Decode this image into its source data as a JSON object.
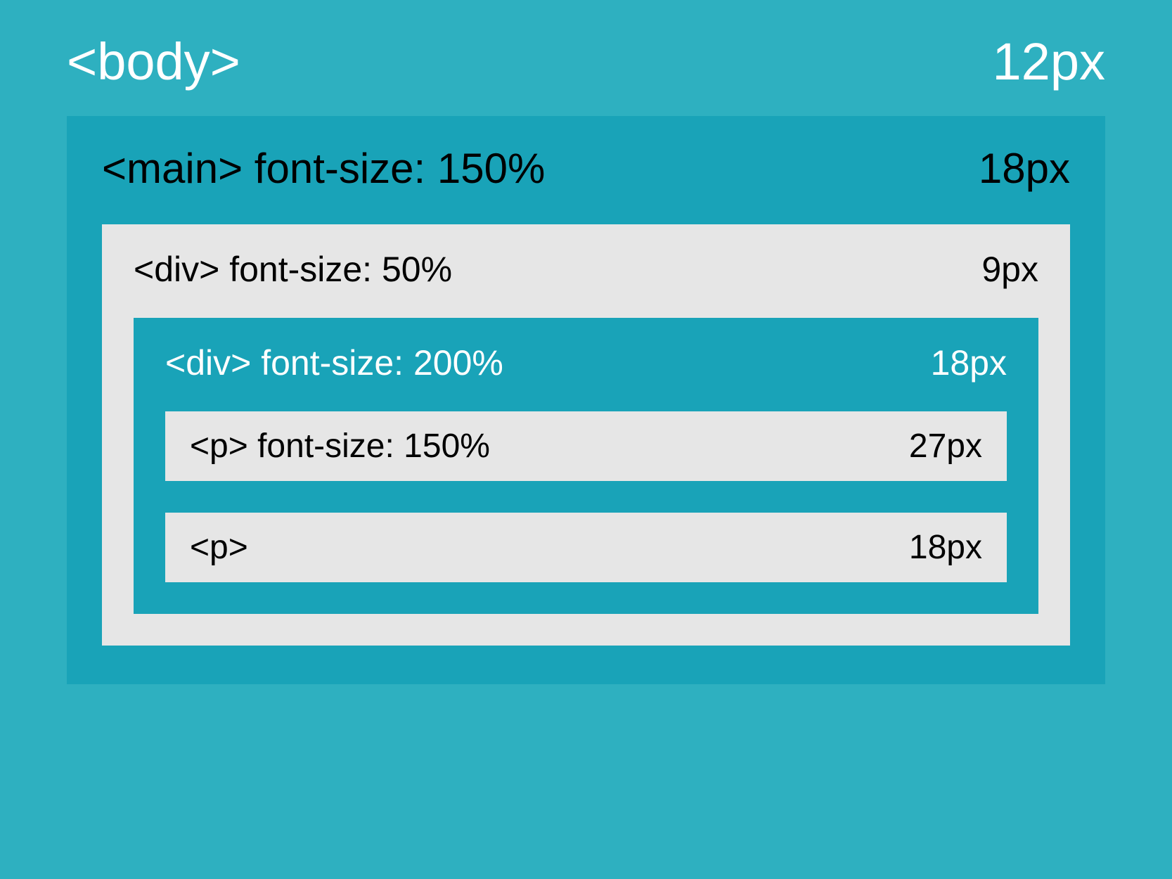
{
  "body": {
    "label": "<body>",
    "size": "12px"
  },
  "main": {
    "label": "<main> font-size: 150%",
    "size": "18px"
  },
  "div_outer": {
    "label": "<div> font-size: 50%",
    "size": "9px"
  },
  "div_inner": {
    "label": "<div> font-size: 200%",
    "size": "18px"
  },
  "p1": {
    "label": "<p> font-size: 150%",
    "size": "27px"
  },
  "p2": {
    "label": "<p>",
    "size": "18px"
  }
}
